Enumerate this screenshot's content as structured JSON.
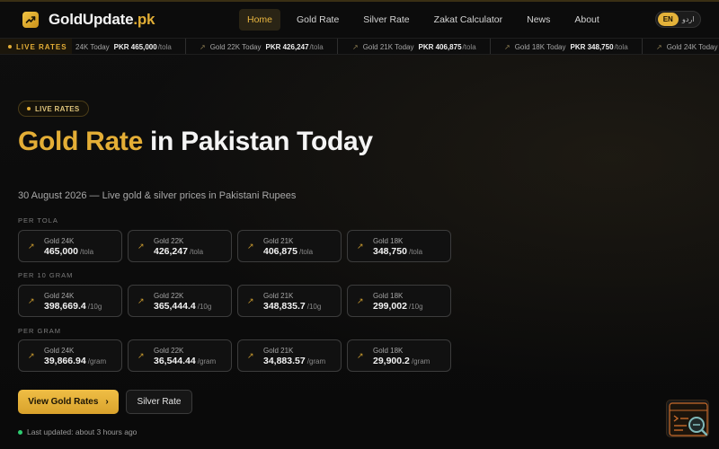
{
  "nav": {
    "logo_name": "GoldUpdate",
    "logo_tld": ".pk",
    "links": [
      "Home",
      "Gold Rate",
      "Silver Rate",
      "Zakat Calculator",
      "News",
      "About"
    ],
    "active_index": 0,
    "lang": {
      "en": "EN",
      "ur": "اردو",
      "active": "EN"
    }
  },
  "ticker": {
    "badge": "LIVE RATES",
    "items": [
      {
        "label": "24K Today",
        "price": "PKR 465,000",
        "unit": "/tola"
      },
      {
        "label": "Gold 22K Today",
        "price": "PKR 426,247",
        "unit": "/tola"
      },
      {
        "label": "Gold 21K Today",
        "price": "PKR 406,875",
        "unit": "/tola"
      },
      {
        "label": "Gold 18K Today",
        "price": "PKR 348,750",
        "unit": "/tola"
      },
      {
        "label": "Gold 24K Today",
        "price": "",
        "unit": ""
      }
    ]
  },
  "hero": {
    "pill": "LIVE RATES",
    "title_gold": "Gold Rate",
    "title_rest": " in Pakistan Today",
    "subtitle": "30 August 2026 — Live gold & silver prices in Pakistani Rupees"
  },
  "sections": [
    {
      "label": "PER TOLA",
      "cards": [
        {
          "name": "Gold 24K",
          "value": "465,000",
          "unit": "/tola"
        },
        {
          "name": "Gold 22K",
          "value": "426,247",
          "unit": "/tola"
        },
        {
          "name": "Gold 21K",
          "value": "406,875",
          "unit": "/tola"
        },
        {
          "name": "Gold 18K",
          "value": "348,750",
          "unit": "/tola"
        }
      ]
    },
    {
      "label": "PER 10 GRAM",
      "cards": [
        {
          "name": "Gold 24K",
          "value": "398,669.4",
          "unit": "/10g"
        },
        {
          "name": "Gold 22K",
          "value": "365,444.4",
          "unit": "/10g"
        },
        {
          "name": "Gold 21K",
          "value": "348,835.7",
          "unit": "/10g"
        },
        {
          "name": "Gold 18K",
          "value": "299,002",
          "unit": "/10g"
        }
      ]
    },
    {
      "label": "PER GRAM",
      "cards": [
        {
          "name": "Gold 24K",
          "value": "39,866.94",
          "unit": "/gram"
        },
        {
          "name": "Gold 22K",
          "value": "36,544.44",
          "unit": "/gram"
        },
        {
          "name": "Gold 21K",
          "value": "34,883.57",
          "unit": "/gram"
        },
        {
          "name": "Gold 18K",
          "value": "29,900.2",
          "unit": "/gram"
        }
      ]
    }
  ],
  "buttons": {
    "primary": "View Gold Rates",
    "primary_icon": "chevron-right-icon",
    "secondary": "Silver Rate"
  },
  "updated": "Last updated: about 3 hours ago",
  "colors": {
    "accent": "#e4ae36",
    "background": "#0b0b0b",
    "status_green": "#2ecc71"
  }
}
